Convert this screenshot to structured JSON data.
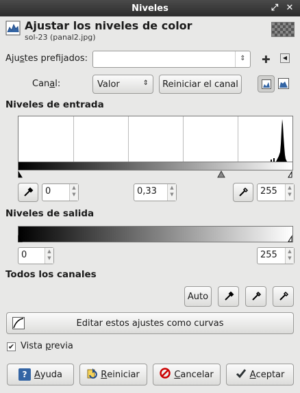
{
  "window": {
    "title": "Niveles"
  },
  "header": {
    "title": "Ajustar los niveles de color",
    "subtitle": "sol-23 (panal2.jpg)"
  },
  "presets": {
    "label_pre": "Aju",
    "label_ul": "s",
    "label_post": "tes prefijados:",
    "value": ""
  },
  "channel": {
    "label_pre": "Can",
    "label_ul": "a",
    "label_post": "l:",
    "value": "Valor",
    "reset_label": "Reiniciar el canal"
  },
  "input_levels": {
    "title": "Niveles de entrada",
    "low": "0",
    "gamma": "0,33",
    "high": "255"
  },
  "output_levels": {
    "title": "Niveles de salida",
    "low": "0",
    "high": "255"
  },
  "all_channels": {
    "title": "Todos los canales",
    "auto_label": "Auto"
  },
  "edit_curves": {
    "label": "Editar estos ajustes como curvas"
  },
  "preview": {
    "label_pre": "Vista ",
    "label_ul": "p",
    "label_post": "revia",
    "checked": true
  },
  "buttons": {
    "help": {
      "ul": "A",
      "rest": "yuda"
    },
    "reset": {
      "ul": "R",
      "rest": "einiciar"
    },
    "cancel": {
      "ul": "C",
      "rest": "ancelar"
    },
    "ok": {
      "ul": "A",
      "rest": "ceptar"
    }
  },
  "colors": {
    "accent": "#3465a4",
    "cancel_red": "#cc0000",
    "ok_check": "#2e3436"
  }
}
